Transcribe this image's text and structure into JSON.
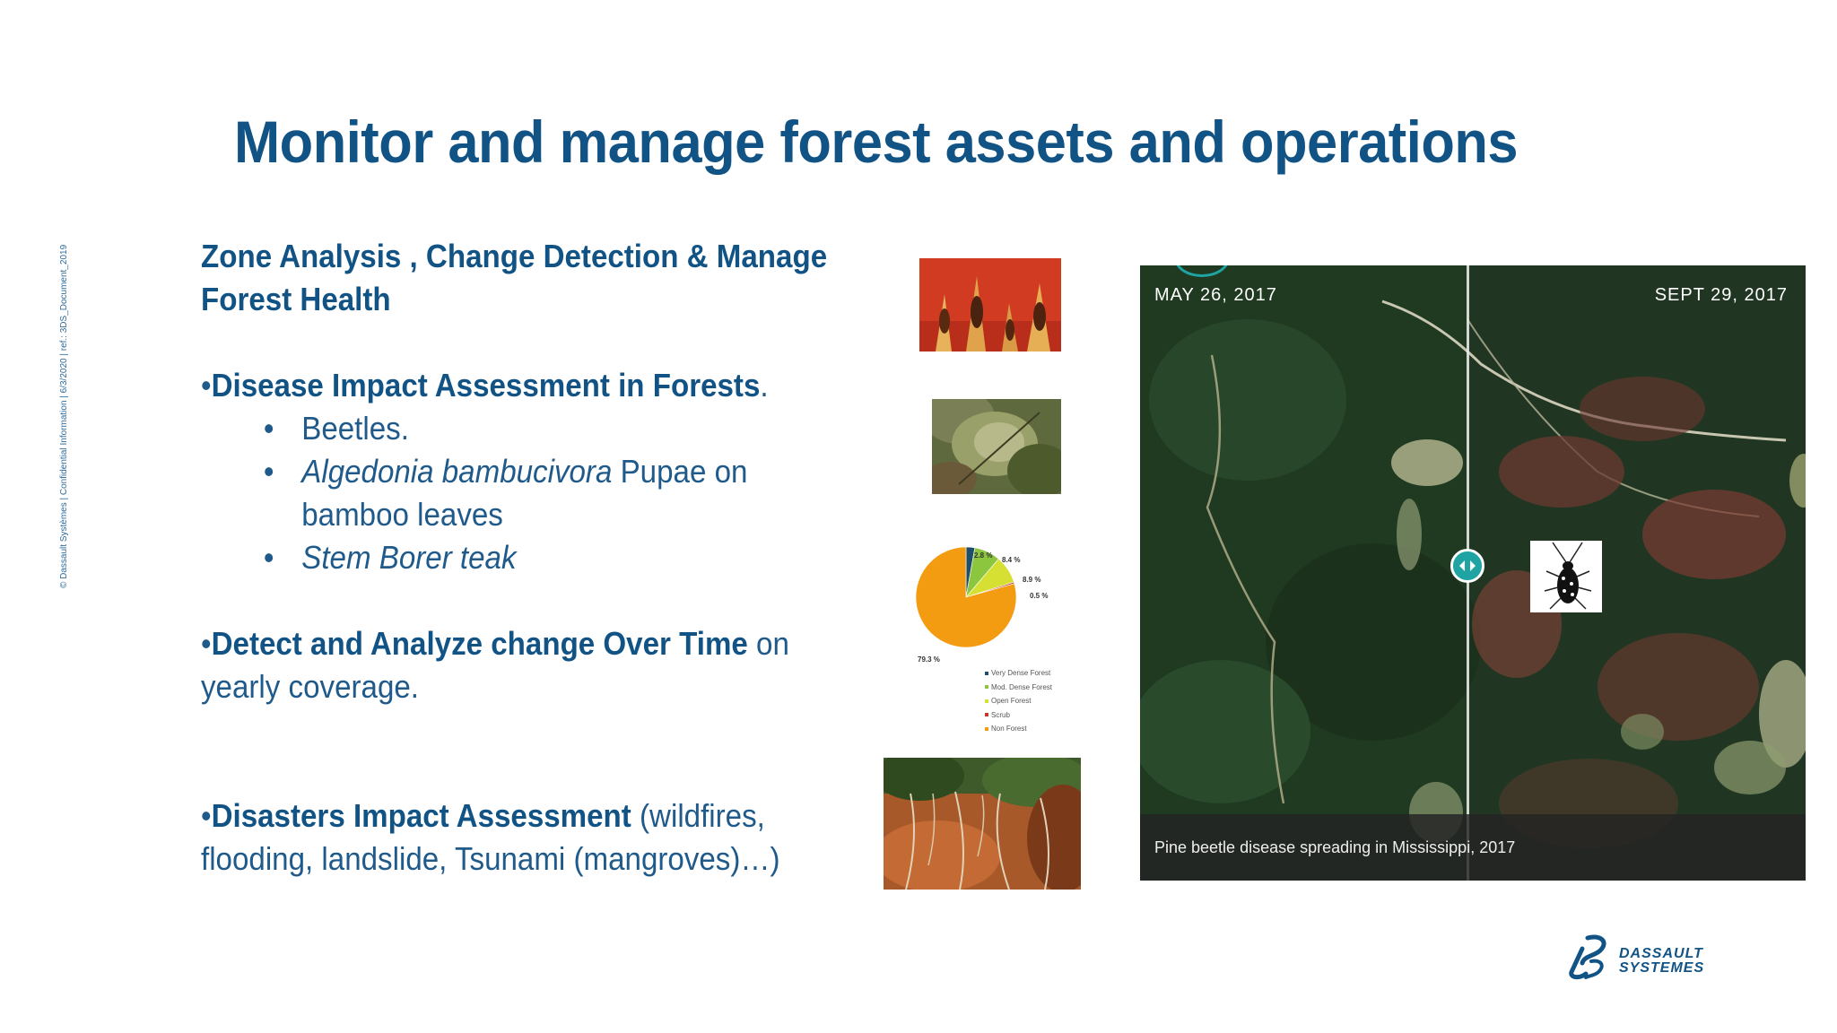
{
  "slide": {
    "title": "Monitor and manage forest assets and operations",
    "confidential_note": "© Dassault Systèmes | Confidential Information | 6/3/2020 | ref.: 3DS_Document_2019"
  },
  "content": {
    "heading": "Zone Analysis , Change Detection & Manage Forest Health",
    "disease": {
      "bullet": "•",
      "title": "Disease Impact Assessment in Forests",
      "suffix": ".",
      "items": [
        {
          "text": "Beetles."
        },
        {
          "italic": "Algedonia bambucivora",
          "text": " Pupae on bamboo  leaves"
        },
        {
          "italic": "Stem Borer teak"
        }
      ],
      "sub_bullet": "•"
    },
    "detect": {
      "bullet": "•",
      "title": "Detect and Analyze change Over Time",
      "rest": " on yearly  coverage."
    },
    "disasters": {
      "bullet": "•",
      "title": "Disasters Impact Assessment",
      "rest": " (wildfires, flooding,  landslide, Tsunami (mangroves)…)"
    }
  },
  "pie_chart": {
    "labels": {
      "very_dense": "2.8 %",
      "mod_dense": "8.4 %",
      "open": "8.9 %",
      "scrub": "0.5 %",
      "non_forest": "79.3 %"
    },
    "legend": [
      {
        "name": "Very Dense Forest",
        "color": "#1f4e6b"
      },
      {
        "name": "Mod. Dense Forest",
        "color": "#8cc63f"
      },
      {
        "name": "Open Forest",
        "color": "#d6e033"
      },
      {
        "name": "Scrub",
        "color": "#c0392b"
      },
      {
        "name": "Non Forest",
        "color": "#f39c12"
      }
    ]
  },
  "chart_data": {
    "type": "pie",
    "categories": [
      "Very Dense Forest",
      "Mod. Dense Forest",
      "Open Forest",
      "Scrub",
      "Non Forest"
    ],
    "values": [
      2.8,
      8.4,
      8.9,
      0.5,
      79.3
    ],
    "colors": [
      "#1f4e6b",
      "#8cc63f",
      "#d6e033",
      "#c0392b",
      "#f39c12"
    ],
    "legend": "bottom-right"
  },
  "satellite": {
    "date_left": "MAY 26, 2017",
    "date_right": "SEPT 29, 2017",
    "caption": "Pine beetle disease spreading in Mississippi, 2017"
  },
  "logo": {
    "line1": "DASSAULT",
    "line2": "SYSTEMES",
    "color": "#125386"
  },
  "colors": {
    "title": "#125386",
    "body": "#1f5a8b",
    "accent": "#1fa3a3"
  },
  "icons": [
    "slider-arrows-icon",
    "beetle-icon",
    "dassault-logo-icon"
  ]
}
